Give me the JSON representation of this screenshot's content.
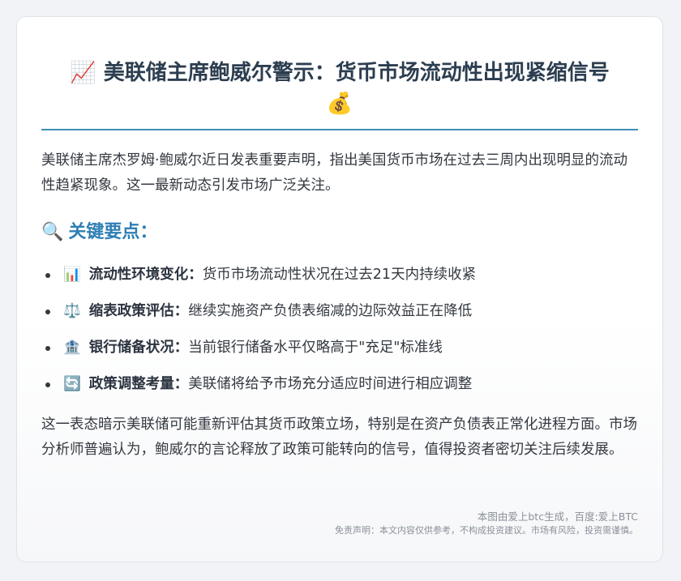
{
  "article": {
    "title_emoji": "📈",
    "title_text": "美联储主席鲍威尔警示：货币市场流动性出现紧缩信号",
    "title_emoji_end": "💰",
    "intro": "美联储主席杰罗姆·鲍威尔近日发表重要声明，指出美国货币市场在过去三周内出现明显的流动性趋紧现象。这一最新动态引发市场广泛关注。",
    "key_points_heading_emoji": "🔍",
    "key_points_heading": "关键要点：",
    "key_points": [
      {
        "icon": "📊",
        "icon_name": "bar-chart-icon",
        "label": "流动性环境变化：",
        "text": "货币市场流动性状况在过去21天内持续收紧"
      },
      {
        "icon": "⚖️",
        "icon_name": "scales-icon",
        "label": "缩表政策评估：",
        "text": "继续实施资产负债表缩减的边际效益正在降低"
      },
      {
        "icon": "🏦",
        "icon_name": "bank-icon",
        "label": "银行储备状况：",
        "text": "当前银行储备水平仅略高于\"充足\"标准线"
      },
      {
        "icon": "🔄",
        "icon_name": "cycle-arrows-icon",
        "label": "政策调整考量：",
        "text": "美联储将给予市场充分适应时间进行相应调整"
      }
    ],
    "conclusion": "这一表态暗示美联储可能重新评估其货币政策立场，特别是在资产负债表正常化进程方面。市场分析师普遍认为，鲍威尔的言论释放了政策可能转向的信号，值得投资者密切关注后续发展。"
  },
  "footer": {
    "credit": "本图由爱上btc生成，百度:爱上BTC",
    "disclaimer": "免责声明：本文内容仅供参考，不构成投资建议。市场有风险，投资需谨慎。"
  },
  "colors": {
    "title": "#2c3e50",
    "accent": "#2f7fb4",
    "divider": "#3f8fb8",
    "body_text": "#333940"
  }
}
